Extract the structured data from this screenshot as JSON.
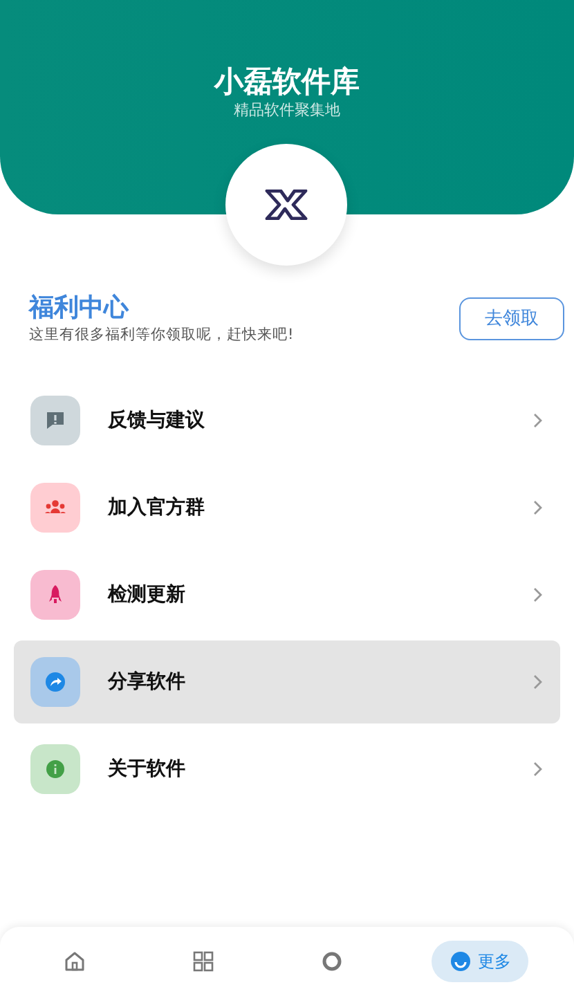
{
  "header": {
    "title": "小磊软件库",
    "subtitle": "精品软件聚集地"
  },
  "welfare": {
    "title": "福利中心",
    "description": "这里有很多福利等你领取呢，赶快来吧!",
    "button": "去领取"
  },
  "menu": [
    {
      "kind": "feedback",
      "label": "反馈与建议",
      "color": "#cfd8dc",
      "selected": false
    },
    {
      "kind": "group",
      "label": "加入官方群",
      "color": "#ffcdd2",
      "selected": false
    },
    {
      "kind": "rocket",
      "label": "检测更新",
      "color": "#f8bbd0",
      "selected": false
    },
    {
      "kind": "share",
      "label": "分享软件",
      "color": "#a9c9ea",
      "selected": true
    },
    {
      "kind": "info",
      "label": "关于软件",
      "color": "#c8e6c9",
      "selected": false
    }
  ],
  "bottom_nav": [
    {
      "kind": "home",
      "selected": false
    },
    {
      "kind": "grid",
      "selected": false
    },
    {
      "kind": "discover",
      "selected": false
    },
    {
      "kind": "more",
      "label": "更多",
      "selected": true
    }
  ]
}
